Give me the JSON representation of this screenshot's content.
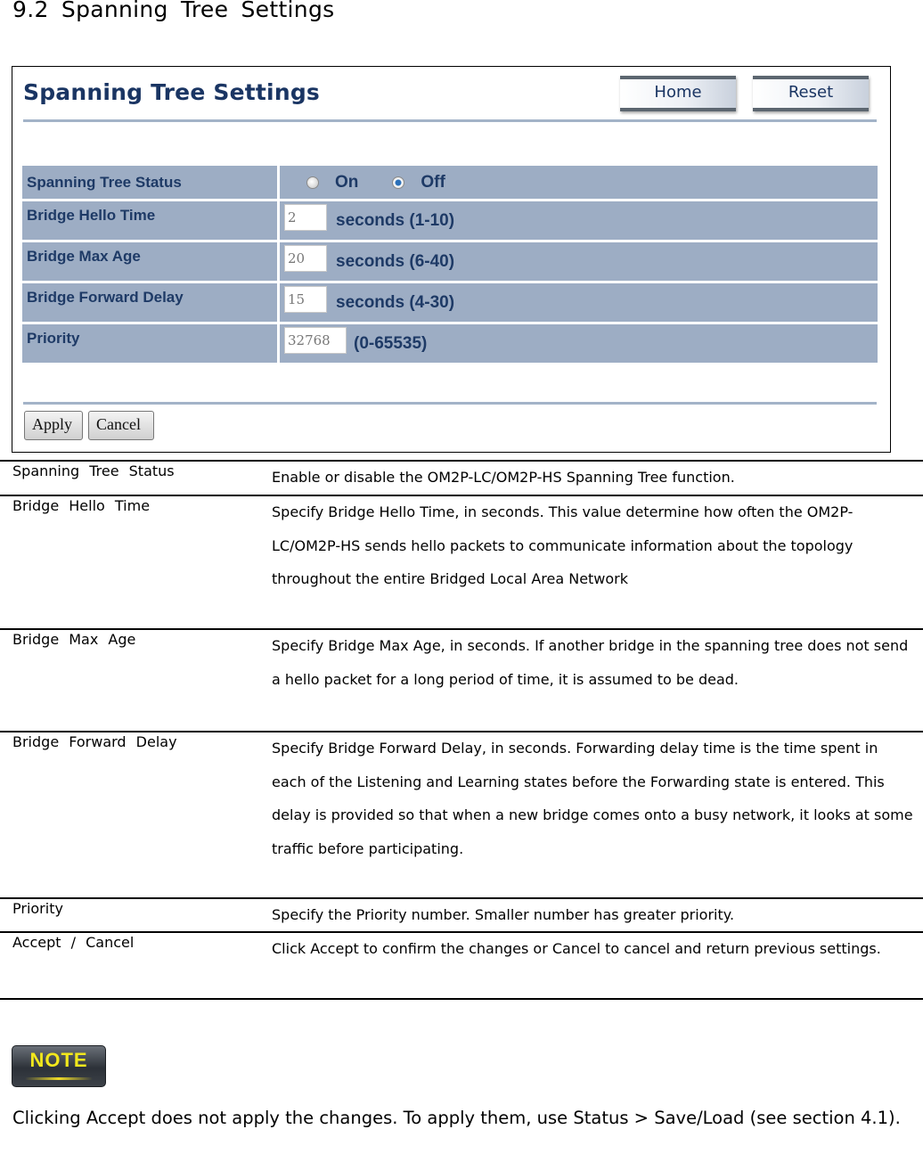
{
  "document": {
    "heading": "9.2 Spanning Tree Settings"
  },
  "panel": {
    "title": "Spanning Tree Settings",
    "home_label": "Home",
    "reset_label": "Reset",
    "rows": [
      {
        "label": "Spanning Tree Status",
        "options": [
          "On",
          "Off"
        ],
        "selected": "Off"
      },
      {
        "label": "Bridge Hello Time",
        "value": "2",
        "suffix": "seconds (1-10)"
      },
      {
        "label": "Bridge Max Age",
        "value": "20",
        "suffix": "seconds (6-40)"
      },
      {
        "label": "Bridge Forward Delay",
        "value": "15",
        "suffix": "seconds (4-30)"
      },
      {
        "label": "Priority",
        "value": "32768",
        "suffix": "(0-65535)"
      }
    ],
    "apply_label": "Apply",
    "cancel_label": "Cancel"
  },
  "descriptions": [
    {
      "term": "Spanning Tree Status",
      "text": "Enable or disable the OM2P-LC/OM2P-HS Spanning Tree function."
    },
    {
      "term": "Bridge Hello Time",
      "text": "Specify Bridge Hello Time, in seconds. This value determine how often the OM2P-LC/OM2P-HS sends hello packets to communicate information about the topology throughout the entire Bridged Local Area Network"
    },
    {
      "term": "Bridge Max Age",
      "text": "Specify Bridge Max Age, in seconds. If another bridge in the spanning tree does not send a hello packet for a long period of time, it is assumed to be dead."
    },
    {
      "term": "Bridge Forward Delay",
      "text": "Specify Bridge Forward Delay, in seconds. Forwarding delay time is the time spent in each of the Listening and Learning states before the Forwarding state is entered. This delay is provided so that when a new bridge comes onto a busy network, it looks at some traffic before participating."
    },
    {
      "term": "Priority",
      "text": "Specify the Priority number. Smaller number has greater priority."
    },
    {
      "term": "Accept / Cancel",
      "text": "Click Accept to confirm the changes or Cancel to cancel and return previous settings."
    }
  ],
  "note": {
    "badge": "NOTE",
    "text": "Clicking Accept does not apply the changes. To apply them, use Status > Save/Load (see section 4.1)."
  }
}
